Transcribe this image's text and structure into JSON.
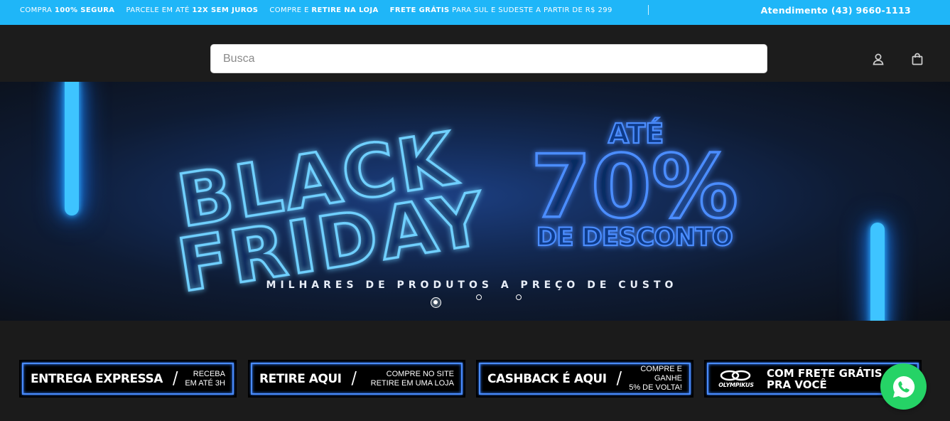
{
  "topbar": {
    "promos": [
      {
        "pre": "COMPRA ",
        "bold": "100% SEGURA",
        "post": ""
      },
      {
        "pre": "PARCELE EM ATÉ ",
        "bold": "12X SEM JUROS",
        "post": ""
      },
      {
        "pre": "COMPRE E ",
        "bold": "RETIRE NA LOJA",
        "post": ""
      },
      {
        "pre": "",
        "bold": "FRETE GRÁTIS",
        "post": " PARA SUL E SUDESTE A PARTIR DE R$ 299"
      }
    ],
    "phone": "Atendimento (43) 9660-1113"
  },
  "header": {
    "search_placeholder": "Busca",
    "icons": [
      "user-icon",
      "shopping-bag-icon"
    ]
  },
  "hero": {
    "title_line1": "BLACK",
    "title_line2": "FRIDAY",
    "offer_top": "ATÉ",
    "offer_value": "70%",
    "offer_bottom": "DE DESCONTO",
    "tagline": "MILHARES DE PRODUTOS A PREÇO DE CUSTO",
    "slides_total": 3,
    "slide_active": 1,
    "accent": "#2f7dff"
  },
  "features": [
    {
      "big": "ENTREGA EXPRESSA",
      "line1": "RECEBA",
      "line2": "EM ATÉ 3H"
    },
    {
      "big": "RETIRE AQUI",
      "line1": "COMPRE NO SITE",
      "line2": "RETIRE EM UMA LOJA"
    },
    {
      "big": "CASHBACK É AQUI",
      "line1": "COMPRE E GANHE",
      "line2": "5% DE VOLTA!"
    },
    {
      "brand": "OLYMPIKUS",
      "line1": "COM FRETE GRÁTIS",
      "line2": "PRA VOCÊ"
    }
  ],
  "colors": {
    "topbar": "#1fb6f8",
    "header": "#1c1c1c",
    "neon": "#3ec4ff",
    "whatsapp": "#25d366"
  }
}
